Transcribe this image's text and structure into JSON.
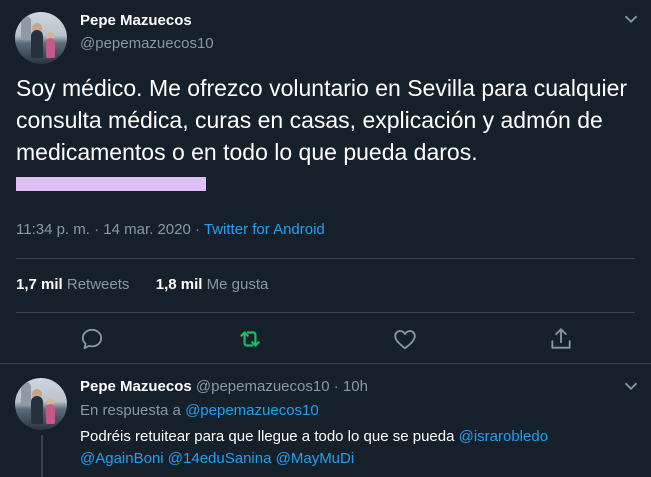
{
  "main_tweet": {
    "author_name": "Pepe Mazuecos",
    "author_handle": "@pepemazuecos10",
    "text": "Soy médico. Me ofrezco voluntario en Sevilla para cualquier consulta médica, curas en casas, explicación y admón de medicamentos o en todo lo que pueda daros.",
    "time": "11:34 p. m. · 14 mar. 2020 · ",
    "source": "Twitter for Android",
    "retweets_count": "1,7 mil",
    "retweets_label": "Retweets",
    "likes_count": "1,8 mil",
    "likes_label": "Me gusta"
  },
  "reply_tweet": {
    "author_name": "Pepe Mazuecos",
    "author_handle": "@pepemazuecos10",
    "dot": " · ",
    "time": "10h",
    "in_reply_prefix": "En respuesta a ",
    "in_reply_mention": "@pepemazuecos10",
    "text": "Podréis retuitear para que llegue a todo lo que se pueda ",
    "mentions": [
      "@israrobledo",
      "@AgainBoni",
      "@14eduSanina",
      "@MayMuDi"
    ]
  },
  "colors": {
    "background": "#15202b",
    "accent": "#1da1f2",
    "muted": "#8899a6",
    "retweet_active": "#17bf63",
    "redaction": "#dfc0f5"
  },
  "icons": [
    "chevron-down-icon",
    "reply-icon",
    "retweet-icon",
    "like-icon",
    "share-icon"
  ]
}
